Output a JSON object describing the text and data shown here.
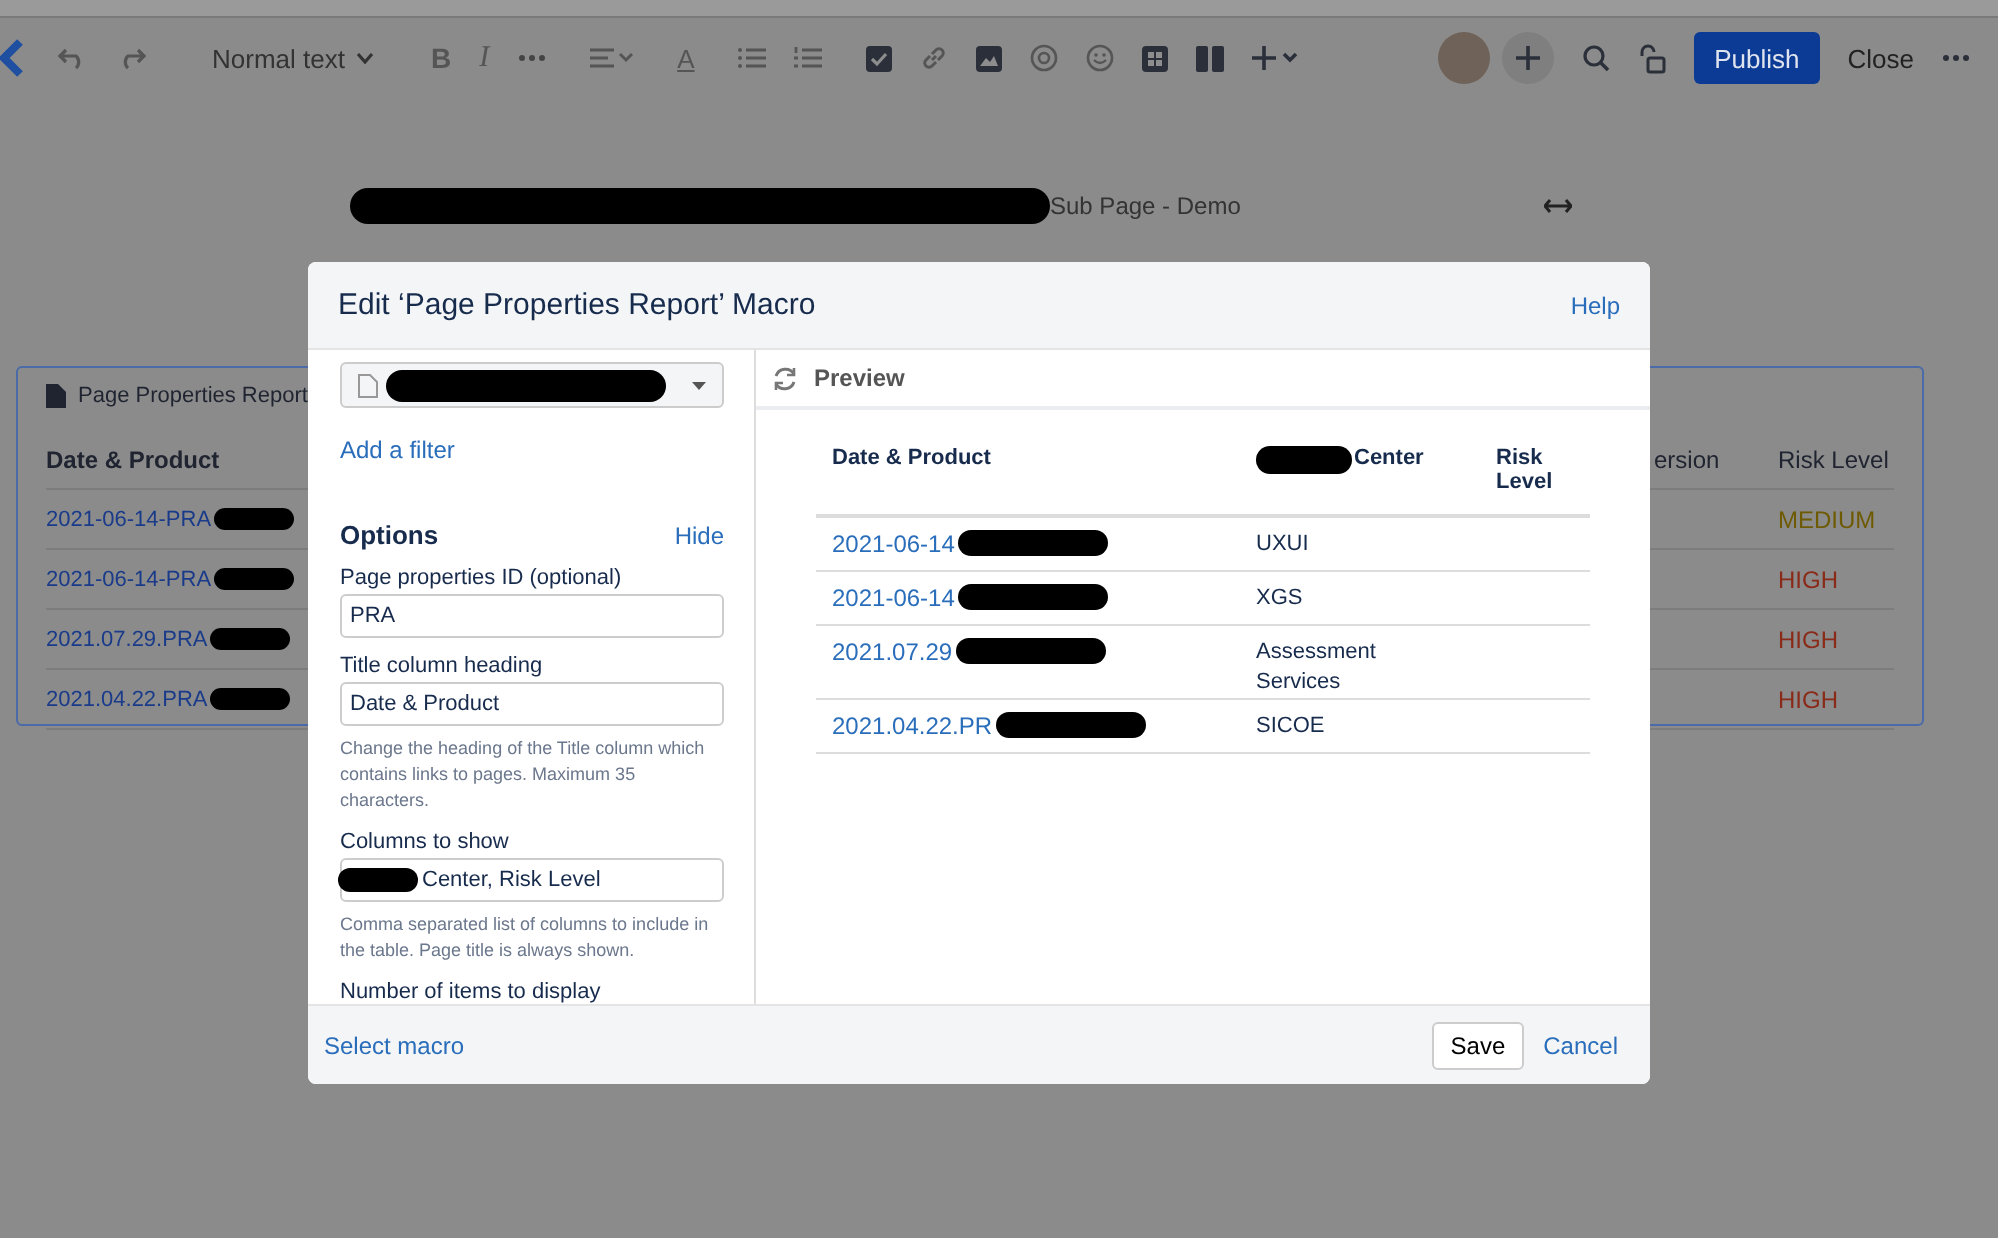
{
  "toolbar": {
    "text_style": "Normal text",
    "bold": "B",
    "italic": "I",
    "text_color": "A",
    "publish": "Publish",
    "close": "Close"
  },
  "page": {
    "title": "Sub Page - Demo"
  },
  "report": {
    "title": "Page Properties Report",
    "columns": [
      "Date & Product",
      "ersion",
      "Risk Level"
    ],
    "rows": [
      {
        "title": "2021-06-14-PRA",
        "risk": "MEDIUM",
        "color": "#6e5a00"
      },
      {
        "title": "2021-06-14-PRA",
        "risk": "HIGH",
        "color": "#8a2a18"
      },
      {
        "title": "2021.07.29.PRA",
        "risk": "HIGH",
        "color": "#8a2a18"
      },
      {
        "title": "2021.04.22.PRA",
        "risk": "HIGH",
        "color": "#8a2a18"
      }
    ]
  },
  "dialog": {
    "title": "Edit ‘Page Properties Report’ Macro",
    "help": "Help",
    "add_filter": "Add a filter",
    "options_heading": "Options",
    "hide": "Hide",
    "fields": [
      {
        "label": "Page properties ID (optional)",
        "value": "PRA",
        "redacted": false
      },
      {
        "label": "Title column heading",
        "value": "Date & Product",
        "redacted": false,
        "hint": "Change the heading of the Title column which contains links to pages. Maximum 35 characters."
      },
      {
        "label": "Columns to show",
        "value": "Center, Risk Level",
        "redacted": true,
        "hint": "Comma separated list of columns to include in the table. Page title is always shown."
      }
    ],
    "next_label": "Number of items to display",
    "preview": {
      "title": "Preview",
      "columns": [
        "Date & Product",
        "Center",
        "Risk Level"
      ],
      "rows": [
        {
          "title": "2021-06-14",
          "center": "UXUI"
        },
        {
          "title": "2021-06-14",
          "center": "XGS"
        },
        {
          "title": "2021.07.29",
          "center": "Assessment Services"
        },
        {
          "title": "2021.04.22.PR",
          "center": "SICOE"
        }
      ]
    },
    "select_macro": "Select macro",
    "save": "Save",
    "cancel": "Cancel"
  }
}
